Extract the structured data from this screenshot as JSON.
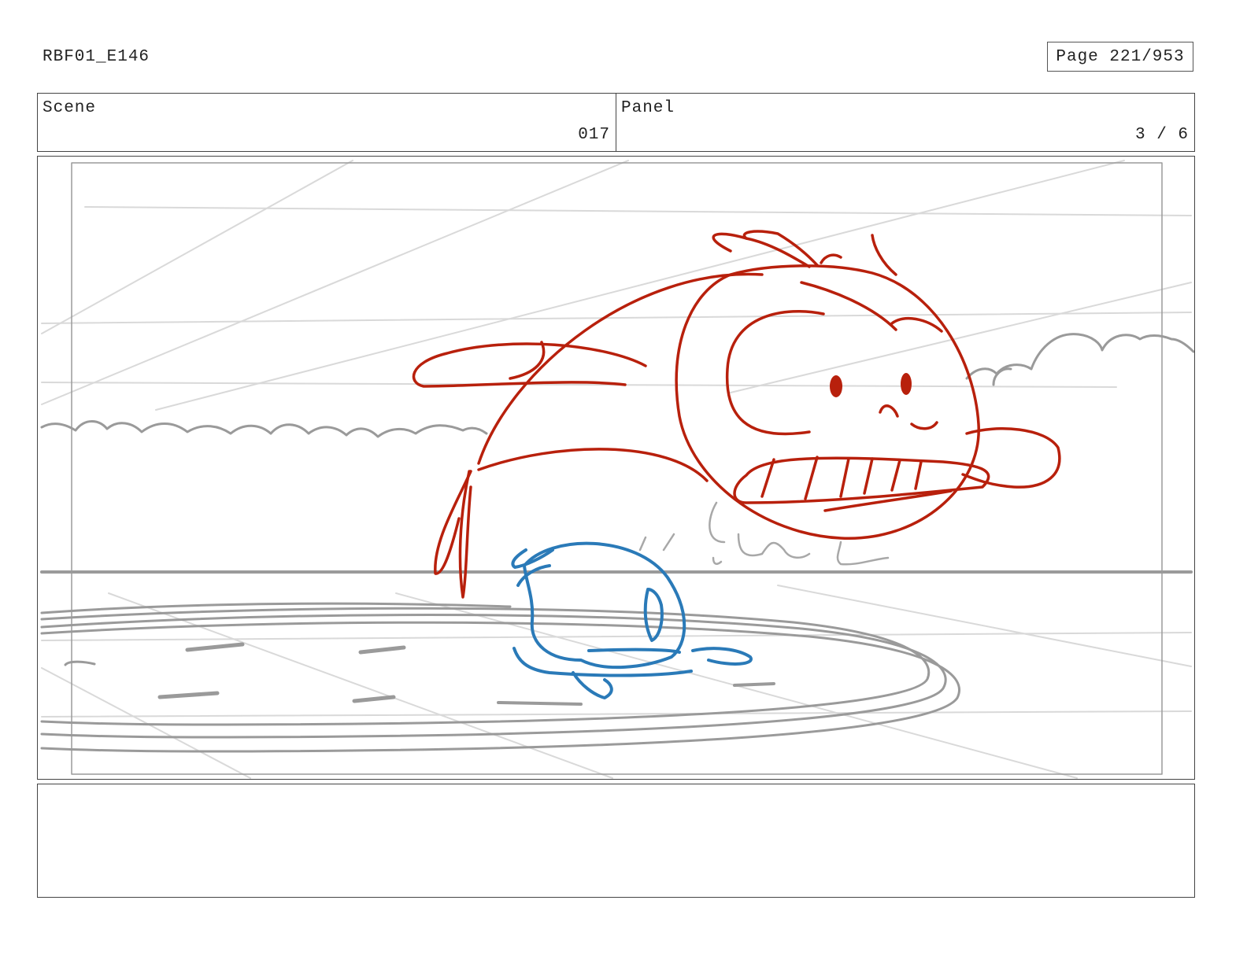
{
  "document": {
    "id": "RBF01_E146",
    "page_label": "Page 221/953"
  },
  "header": {
    "scene": {
      "label": "Scene",
      "value": "017"
    },
    "panel": {
      "label": "Panel",
      "value": "3 / 6"
    }
  },
  "drawing": {
    "colors": {
      "red_character": "#b8200c",
      "blue_character": "#2a7ab8",
      "background_sketch": "#9a9a9a",
      "guide_lines": "#d6d6d6"
    }
  },
  "notes": {
    "text": ""
  }
}
